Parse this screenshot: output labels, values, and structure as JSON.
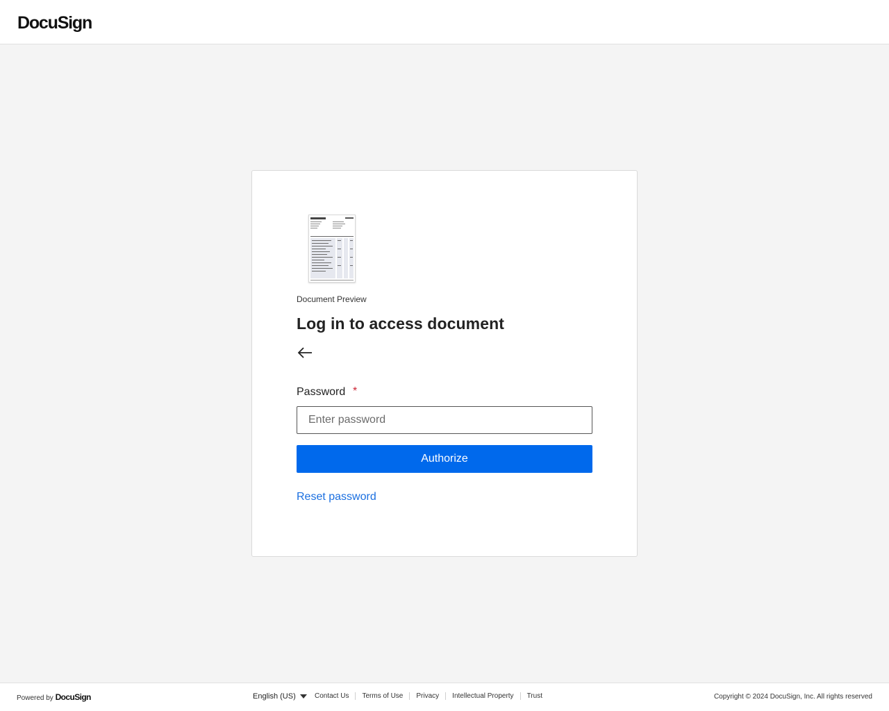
{
  "header": {
    "logo_text": "DocuSign"
  },
  "card": {
    "document_caption": "Document Preview",
    "title": "Log in to access document",
    "password_label": "Password",
    "required_marker": "*",
    "password_placeholder": "Enter password",
    "password_value": "",
    "authorize_label": "Authorize",
    "reset_link": "Reset password"
  },
  "footer": {
    "powered_by": "Powered by",
    "powered_logo": "DocuSign",
    "language": "English (US)",
    "links": [
      "Contact Us",
      "Terms of Use",
      "Privacy",
      "Intellectual Property",
      "Trust"
    ],
    "copyright": "Copyright © 2024 DocuSign, Inc. All rights reserved"
  },
  "colors": {
    "accent": "#0069ec",
    "link": "#1a6fe0",
    "required": "#cc2535",
    "background": "#f4f4f4"
  },
  "icons": {
    "back": "arrow-left-icon",
    "language_caret": "caret-down-icon"
  }
}
